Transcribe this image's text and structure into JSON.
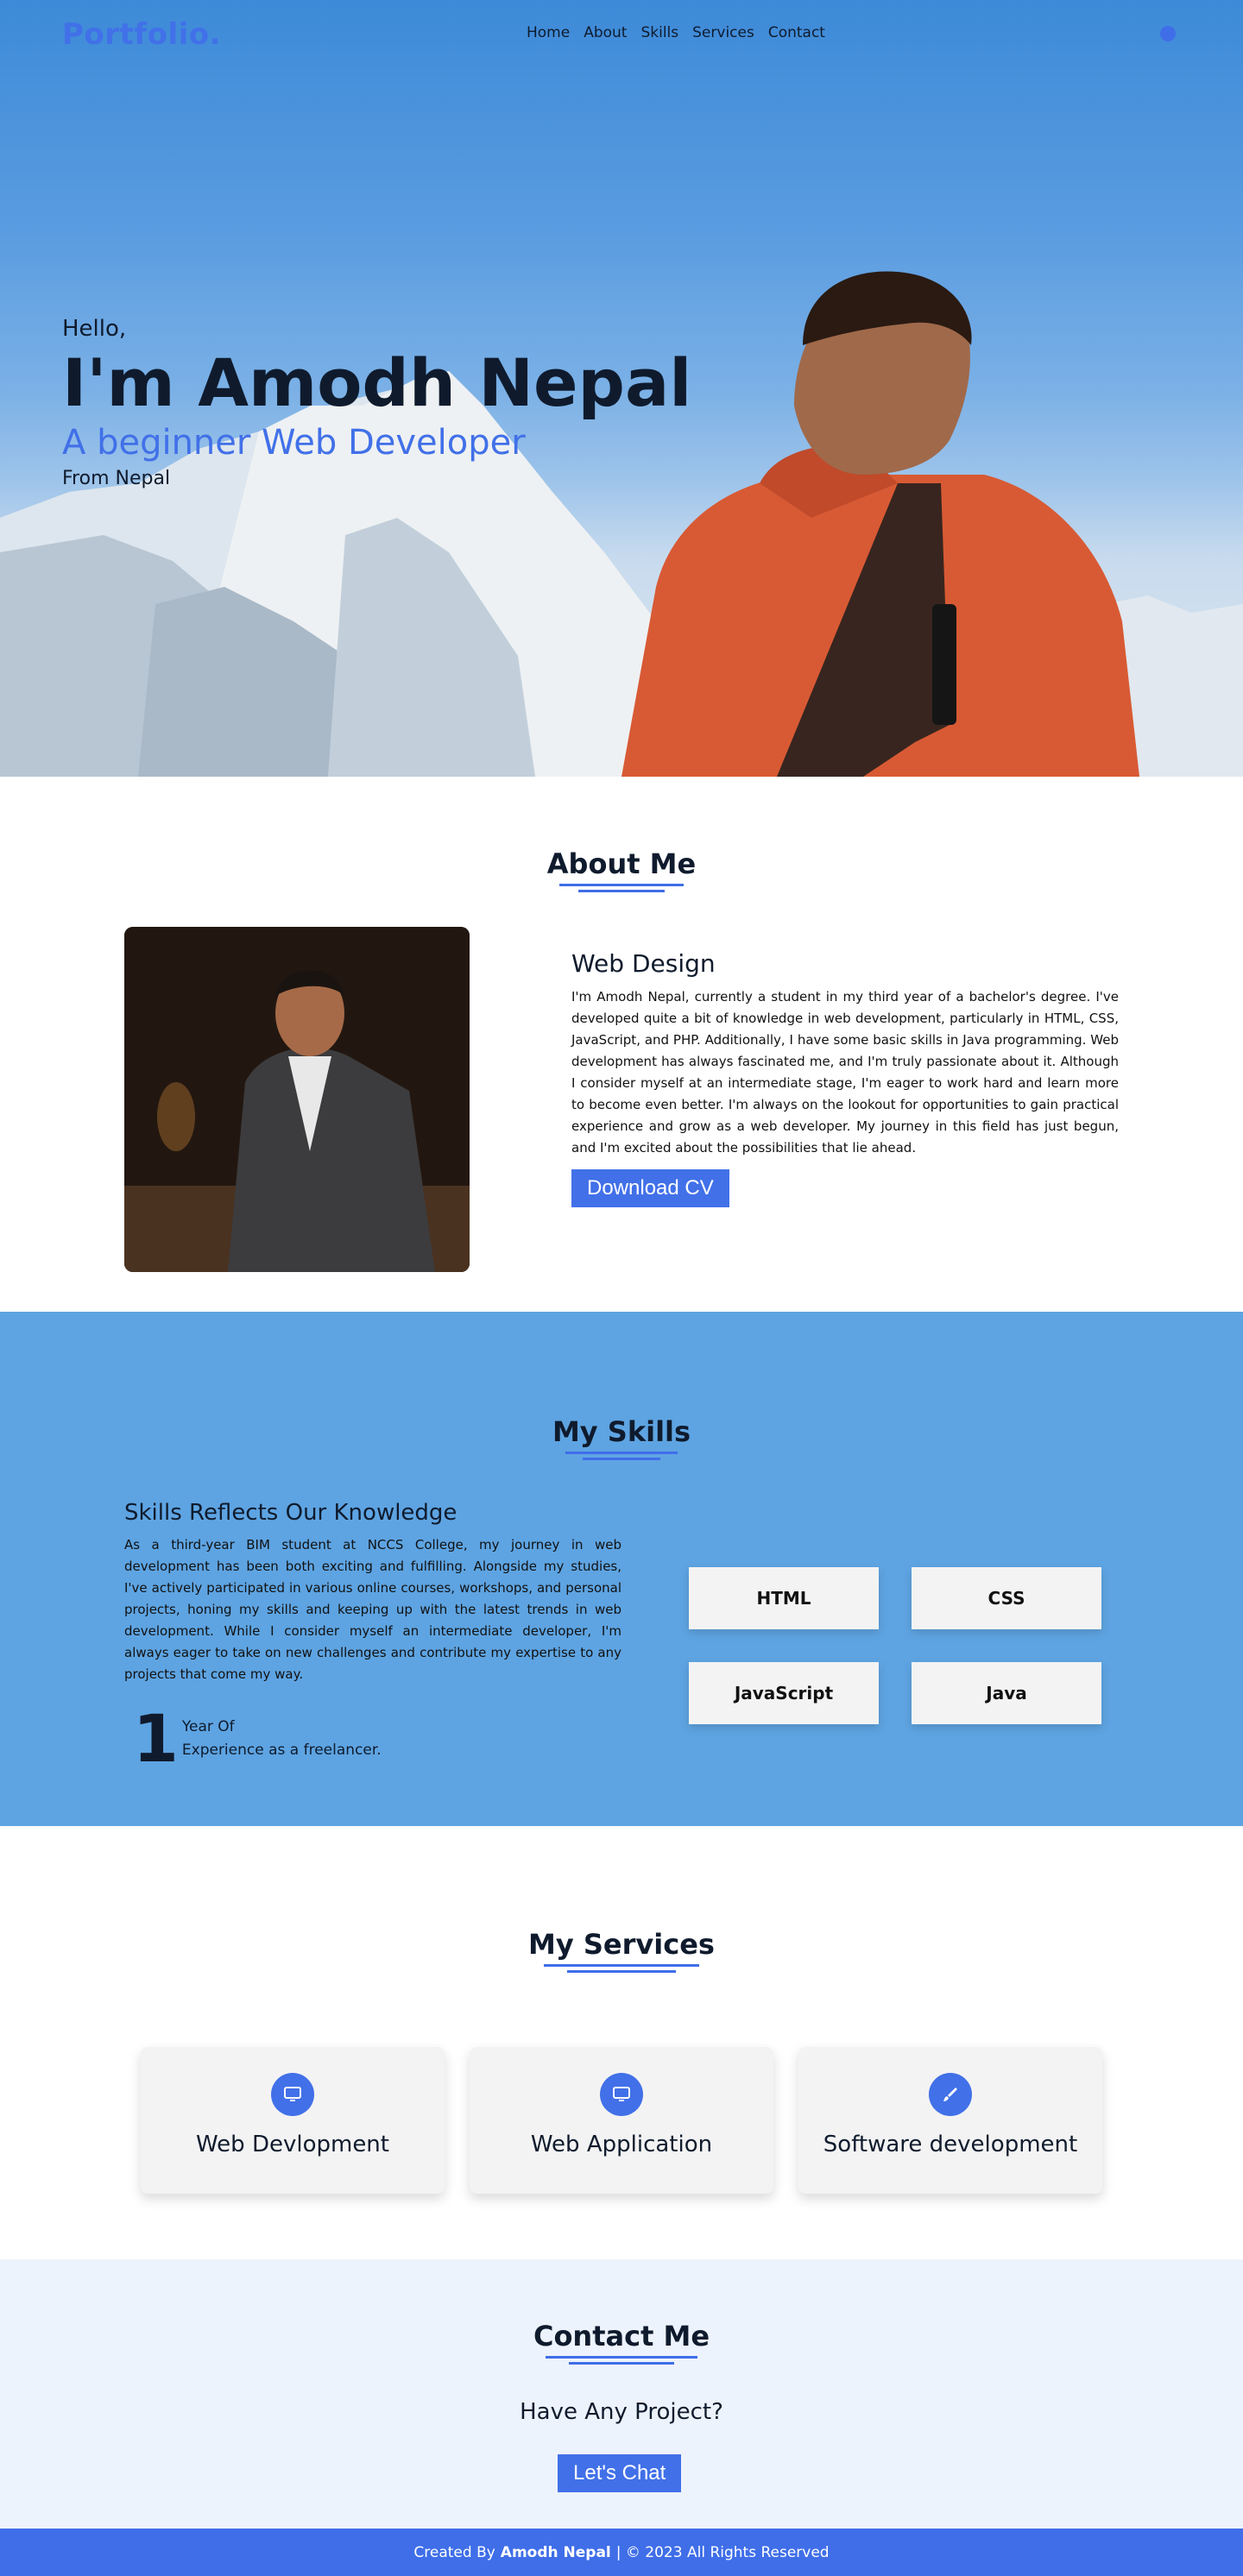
{
  "nav": {
    "logo": "Portfolio.",
    "links": [
      "Home",
      "About",
      "Skills",
      "Services",
      "Contact"
    ]
  },
  "hero": {
    "hello": "Hello,",
    "name": "I'm Amodh Nepal",
    "role": "A beginner Web Developer",
    "from": "From Nepal"
  },
  "about": {
    "title": "About Me",
    "heading": "Web Design",
    "paragraph": "I'm Amodh Nepal, currently a student in my third year of a bachelor's degree. I've developed quite a bit of knowledge in web development, particularly in HTML, CSS, JavaScript, and PHP. Additionally, I have some basic skills in Java programming. Web development has always fascinated me, and I'm truly passionate about it. Although I consider myself at an intermediate stage, I'm eager to work hard and learn more to become even better. I'm always on the lookout for opportunities to gain practical experience and grow as a web developer. My journey in this field has just begun, and I'm excited about the possibilities that lie ahead.",
    "button": "Download CV"
  },
  "skills": {
    "title": "My Skills",
    "heading": "Skills Reflects Our Knowledge",
    "paragraph": "As a third-year BIM student at NCCS College, my journey in web development has been both exciting and fulfilling. Alongside my studies, I've actively participated in various online courses, workshops, and personal projects, honing my skills and keeping up with the latest trends in web development. While I consider myself an intermediate developer, I'm always eager to take on new challenges and contribute my expertise to any projects that come my way.",
    "experience_number": "1",
    "experience_line1": "Year Of",
    "experience_line2": "Experience as a freelancer.",
    "items": [
      "HTML",
      "CSS",
      "JavaScript",
      "Java"
    ]
  },
  "services": {
    "title": "My Services",
    "items": [
      {
        "label": "Web Devlopment",
        "icon": "monitor-icon"
      },
      {
        "label": "Web Application",
        "icon": "monitor-icon"
      },
      {
        "label": "Software development",
        "icon": "paintbrush-icon"
      }
    ]
  },
  "contact": {
    "title": "Contact Me",
    "question": "Have Any Project?",
    "button": "Let's Chat"
  },
  "footer": {
    "prefix": "Created By",
    "author": "Amodh Nepal",
    "suffix": "| © 2023 All Rights Reserved"
  },
  "colors": {
    "accent": "#4170e8",
    "skills_bg": "#5ea4e2",
    "contact_bg": "#edf3fc",
    "card_bg": "#f3f3f3"
  }
}
